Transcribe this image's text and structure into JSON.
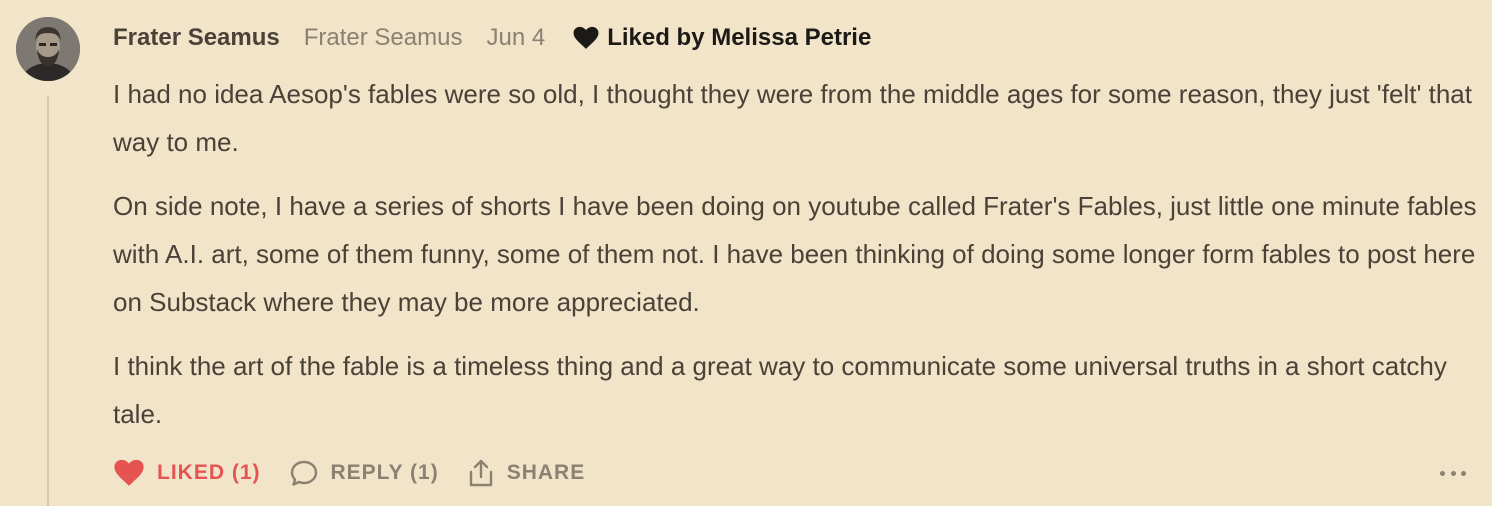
{
  "comment": {
    "author": "Frater Seamus",
    "handle": "Frater Seamus",
    "date": "Jun 4",
    "liked_by": "Liked by Melissa Petrie",
    "avatar_icon": "person-avatar",
    "paragraphs": [
      "I had no idea Aesop's fables were so old, I thought they were from the middle ages for some reason, they just 'felt' that way to me.",
      "On side note, I have a series of shorts I have been doing on youtube called Frater's Fables, just little one minute fables with A.I. art, some of them funny, some of them not. I have been thinking of doing some longer form fables to post here on Substack where they may be more appreciated.",
      "I think the art of the fable is a timeless thing and a great way to communicate some universal truths in a short catchy tale."
    ]
  },
  "actions": {
    "like_label": "LIKED (1)",
    "reply_label": "REPLY (1)",
    "share_label": "SHARE",
    "more_icon": "ellipsis-icon"
  },
  "colors": {
    "background": "#f2e4c9",
    "text": "#4a4238",
    "muted": "#8a8172",
    "liked": "#e65452",
    "thread_line": "#d9c6a3"
  }
}
